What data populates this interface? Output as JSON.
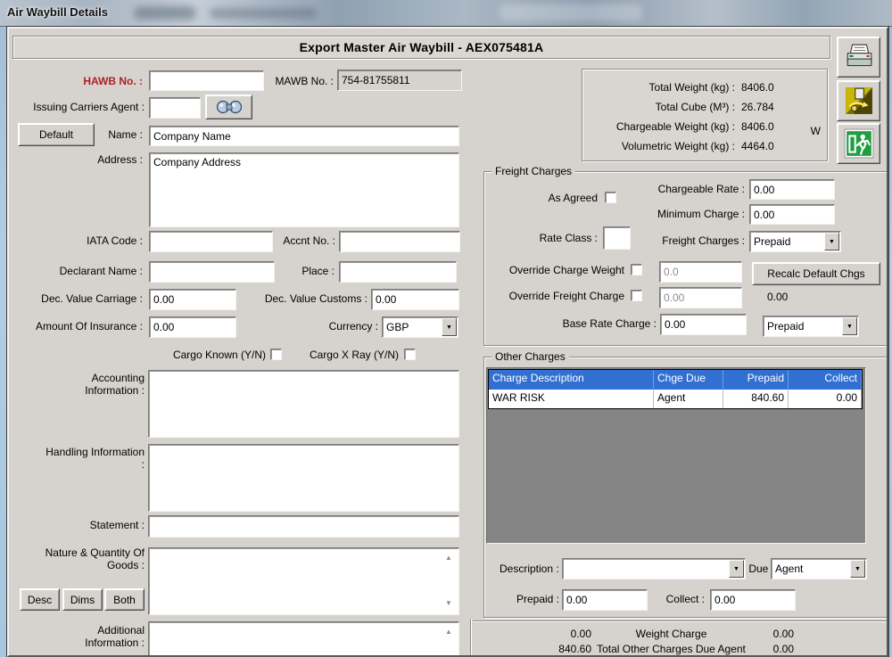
{
  "titlebar": {
    "title": "Air Waybill Details"
  },
  "header": {
    "title": "Export Master Air Waybill - AEX075481A"
  },
  "toolbar": {
    "icons": {
      "print": "printer-icon",
      "save": "save-icon",
      "exit": "exit-icon"
    }
  },
  "weights": {
    "rows": [
      {
        "label": "Total Weight (kg) :",
        "value": "8406.0"
      },
      {
        "label": "Total Cube (M³) :",
        "value": "26.784"
      },
      {
        "label": "Chargeable Weight (kg) :",
        "value": "8406.0"
      },
      {
        "label": "Volumetric Weight (kg) :",
        "value": "4464.0"
      }
    ],
    "weight_flag": "W"
  },
  "fields": {
    "hawb_label": "HAWB No. :",
    "hawb_value": "",
    "mawb_label": "MAWB No. :",
    "mawb_value": "754-81755811",
    "issuing_agent_label": "Issuing Carriers Agent :",
    "issuing_agent_value": "",
    "default_button": "Default",
    "name_label": "Name :",
    "name_value": "Company Name",
    "address_label": "Address :",
    "address_value": "Company Address",
    "iata_label": "IATA Code :",
    "iata_value": "",
    "accnt_label": "Accnt No. :",
    "accnt_value": "",
    "declarant_label": "Declarant Name :",
    "declarant_value": "",
    "place_label": "Place :",
    "place_value": "",
    "dec_carriage_label": "Dec. Value Carriage :",
    "dec_carriage_value": "0.00",
    "dec_customs_label": "Dec. Value Customs :",
    "dec_customs_value": "0.00",
    "insurance_label": "Amount Of Insurance :",
    "insurance_value": "0.00",
    "currency_label": "Currency :",
    "currency_value": "GBP",
    "cargo_known_label": "Cargo Known (Y/N)",
    "cargo_xray_label": "Cargo X Ray (Y/N)",
    "accounting_label": "Accounting Information :",
    "accounting_value": "",
    "handling_label": "Handling Information :",
    "handling_value": "",
    "statement_label": "Statement :",
    "statement_value": "",
    "goods_label": "Nature & Quantity Of Goods :",
    "goods_value": "",
    "desc_button": "Desc",
    "dims_button": "Dims",
    "both_button": "Both",
    "additional_label": "Additional Information :",
    "additional_value": ""
  },
  "freight_charges": {
    "group_title": "Freight Charges",
    "as_agreed_label": "As Agreed",
    "chargeable_rate_label": "Chargeable Rate :",
    "chargeable_rate_value": "0.00",
    "minimum_charge_label": "Minimum Charge :",
    "minimum_charge_value": "0.00",
    "rate_class_label": "Rate Class :",
    "rate_class_value": "",
    "freight_charges_label": "Freight Charges :",
    "freight_charges_value": "Prepaid",
    "override_weight_label": "Override Charge Weight",
    "override_weight_value": "0.0",
    "override_freight_label": "Override Freight Charge",
    "override_freight_value": "0.00",
    "recalc_button": "Recalc Default Chgs",
    "recalc_value": "0.00",
    "base_rate_label": "Base Rate Charge :",
    "base_rate_value": "0.00",
    "base_rate_mode": "Prepaid"
  },
  "other_charges": {
    "group_title": "Other Charges",
    "columns": [
      "Charge Description",
      "Chge Due",
      "Prepaid",
      "Collect"
    ],
    "rows": [
      [
        "WAR RISK",
        "Agent",
        "840.60",
        "0.00"
      ]
    ],
    "description_label": "Description :",
    "description_value": "",
    "due_label": "Due :",
    "due_value": "Agent",
    "prepaid_label": "Prepaid :",
    "prepaid_value": "0.00",
    "collect_label": "Collect :",
    "collect_value": "0.00"
  },
  "totals": {
    "rows": [
      {
        "left": "0.00",
        "label": "Weight Charge",
        "right": "0.00"
      },
      {
        "left": "840.60",
        "label": "Total Other Charges Due Agent",
        "right": "0.00"
      }
    ]
  },
  "colors": {
    "accent_red": "#b01e28",
    "grid_header_blue": "#3170d2",
    "grid_background": "#858585",
    "dialog_background": "#d6d3ce",
    "exit_green": "#1e9e40"
  }
}
